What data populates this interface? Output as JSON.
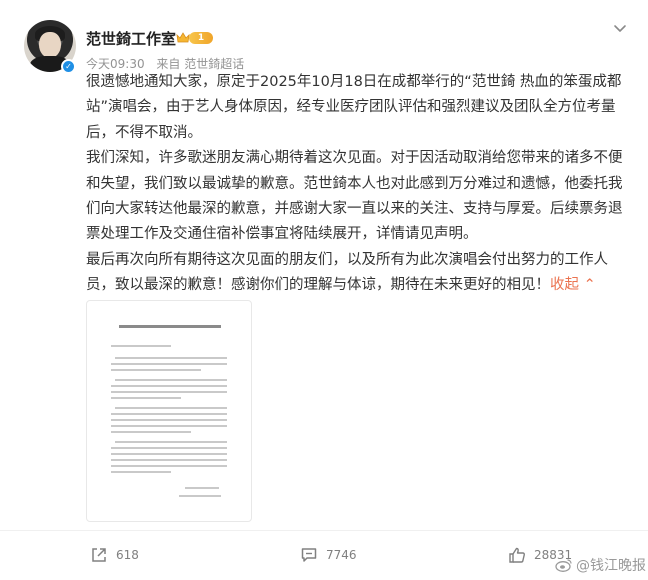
{
  "post": {
    "author": "范世錡工作室",
    "member_level": "1",
    "time": "今天09:30",
    "source": "来自 范世錡超话",
    "paragraphs": [
      "很遗憾地通知大家，原定于2025年10月18日在成都举行的“范世錡 热血的笨蛋成都站”演唱会，由于艺人身体原因，经专业医疗团队评估和强烈建议及团队全方位考量后，不得不取消。",
      "我们深知，许多歌迷朋友满心期待着这次见面。对于因活动取消给您带来的诸多不便和失望，我们致以最诚挚的歉意。范世錡本人也对此感到万分难过和遗憾，他委托我们向大家转达他最深的歉意，并感谢大家一直以来的关注、支持与厚爱。后续票务退票处理工作及交通住宿补偿事宜将陆续展开，详情请见声明。",
      "最后再次向所有期待这次见面的朋友们，以及所有为此次演唱会付出努力的工作人员，致以最深的歉意！感谢你们的理解与体谅，期待在未来更好的相见！"
    ],
    "collapse_label": "收起",
    "collapse_glyph": "⌃"
  },
  "actions": {
    "repost_count": "618",
    "comment_count": "7746",
    "like_count": "28831"
  },
  "watermark": "@钱江晚报",
  "colors": {
    "accent": "#eb7350",
    "verified": "#1f8fe5",
    "badge": "#f0a52a"
  },
  "icons": [
    "verified-icon",
    "crown-icon",
    "chevron-down-icon",
    "repost-icon",
    "comment-icon",
    "like-icon",
    "weibo-logo-icon"
  ]
}
